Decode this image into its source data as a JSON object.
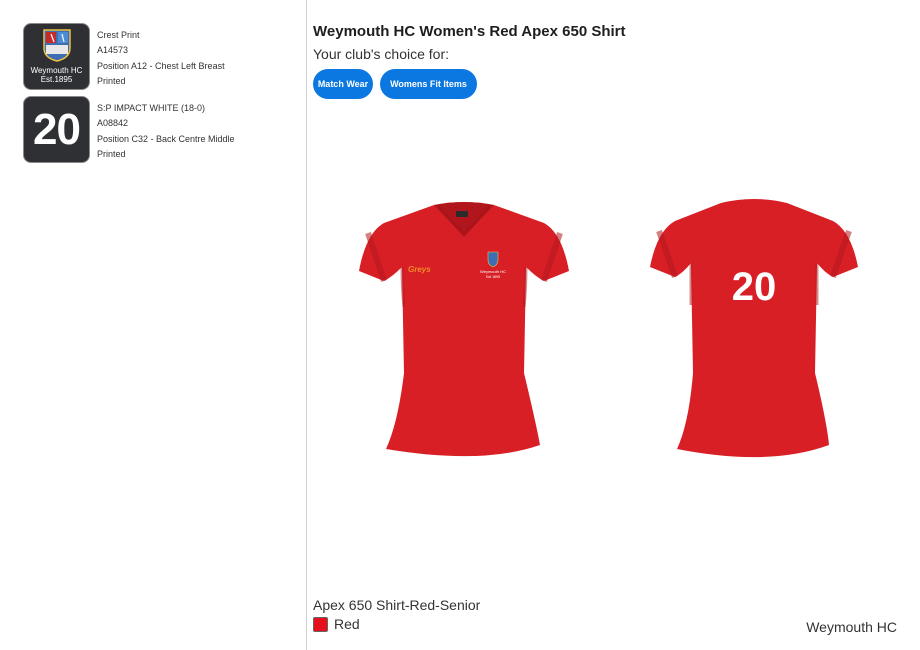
{
  "decorations": [
    {
      "thumb_text_line1": "Weymouth HC",
      "thumb_text_line2": "Est.1895",
      "name": "Crest Print",
      "code": "A14573",
      "position": "Position A12 - Chest Left Breast",
      "method": "Printed"
    },
    {
      "thumb_number": "20",
      "name": "S:P IMPACT WHITE (18-0)",
      "code": "A08842",
      "position": "Position C32 - Back Centre Middle",
      "method": "Printed"
    }
  ],
  "product": {
    "title": "Weymouth HC Women's Red Apex 650 Shirt",
    "subtitle": "Your club's choice for:",
    "tags": [
      "Match Wear",
      "Womens Fit Items"
    ],
    "brand_label": "Greys",
    "crest_label_line1": "Weymouth HC",
    "crest_label_line2": "Est 1895",
    "back_number": "20",
    "variant": "Apex 650 Shirt-Red-Senior",
    "colour_name": "Red",
    "club": "Weymouth HC"
  },
  "colors": {
    "shirt": "#d81f26",
    "swatch": "#e5101b",
    "chip": "#0a78e0",
    "thumb_bg": "#2e3034"
  }
}
